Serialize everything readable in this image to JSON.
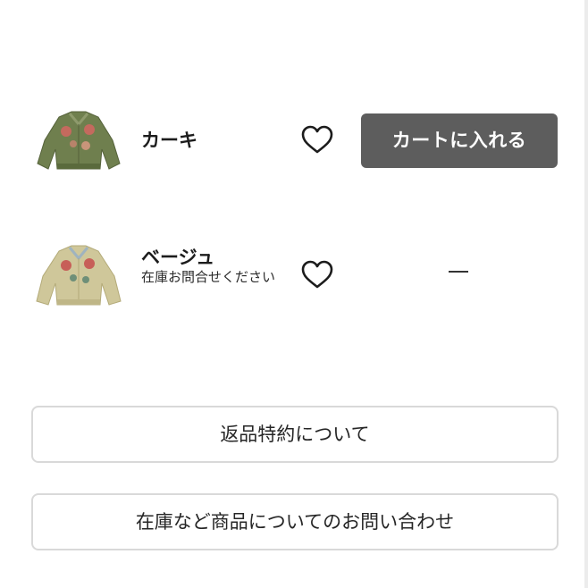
{
  "variants": [
    {
      "color_label": "カーキ",
      "thumbnail_color": "#6f7f4e",
      "action_label": "カートに入れる"
    },
    {
      "color_label": "ベージュ",
      "thumbnail_color": "#cfc79a",
      "stock_note": "在庫お問合せください",
      "action_placeholder": "—"
    }
  ],
  "links": {
    "return_policy_label": "返品特約について",
    "inquiry_label": "在庫など商品についてのお問い合わせ"
  },
  "colors": {
    "cart_button_bg": "#5d5d5d",
    "outline_border": "#d9d9d9",
    "text": "#1f1f1f"
  },
  "icons": {
    "favorite": "heart-outline-icon"
  }
}
